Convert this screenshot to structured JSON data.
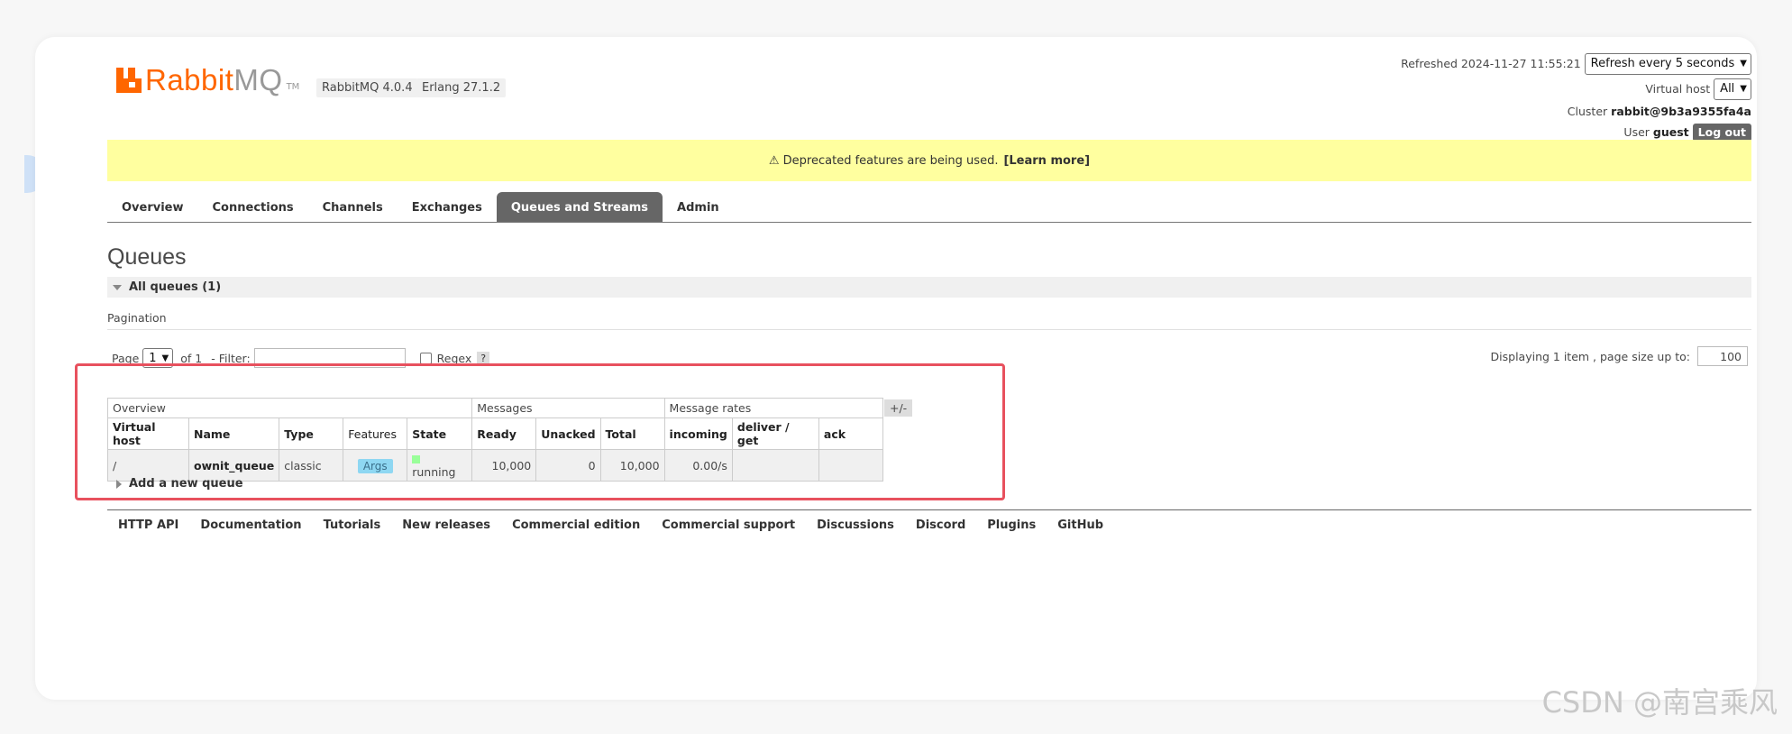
{
  "header": {
    "logo_rabbit": "Rabbit",
    "logo_mq": "MQ",
    "logo_tm": "TM",
    "rabbitmq_version": "RabbitMQ 4.0.4",
    "erlang_version": "Erlang 27.1.2",
    "refreshed_label": "Refreshed 2024-11-27 11:55:21",
    "refresh_select": "Refresh every 5 seconds",
    "vhost_label": "Virtual host",
    "vhost_select": "All",
    "cluster_label": "Cluster",
    "cluster_name": "rabbit@9b3a9355fa4a",
    "user_label": "User",
    "user_name": "guest",
    "logout": "Log out"
  },
  "banner": {
    "text": "⚠ Deprecated features are being used.",
    "link": "[Learn more]"
  },
  "tabs": [
    "Overview",
    "Connections",
    "Channels",
    "Exchanges",
    "Queues and Streams",
    "Admin"
  ],
  "active_tab": "Queues and Streams",
  "page_title": "Queues",
  "section_title": "All queues (1)",
  "pagination": {
    "label": "Pagination",
    "page_label": "Page",
    "page_value": "1",
    "of_label": "of 1",
    "filter_label": "- Filter:",
    "regex_label": "Regex",
    "help": "?",
    "displaying": "Displaying 1 item , page size up to:",
    "page_size": "100"
  },
  "table": {
    "groups": [
      "Overview",
      "Messages",
      "Message rates"
    ],
    "columns": [
      "Virtual host",
      "Name",
      "Type",
      "Features",
      "State",
      "Ready",
      "Unacked",
      "Total",
      "incoming",
      "deliver / get",
      "ack"
    ],
    "row": {
      "vhost": "/",
      "name": "ownit_queue",
      "type": "classic",
      "features": "Args",
      "state": "running",
      "ready": "10,000",
      "unacked": "0",
      "total": "10,000",
      "incoming": "0.00/s",
      "deliver_get": "",
      "ack": ""
    },
    "toggle": "+/-"
  },
  "add_queue": "Add a new queue",
  "footer": [
    "HTTP API",
    "Documentation",
    "Tutorials",
    "New releases",
    "Commercial edition",
    "Commercial support",
    "Discussions",
    "Discord",
    "Plugins",
    "GitHub"
  ],
  "watermark": "CSDN @南宫乘风",
  "colors": {
    "brand": "#ff6600",
    "banner": "#ffff9f",
    "active_tab": "#666666",
    "highlight": "#e8515e",
    "args_badge": "#8ed7f2",
    "running": "#99ff99"
  }
}
